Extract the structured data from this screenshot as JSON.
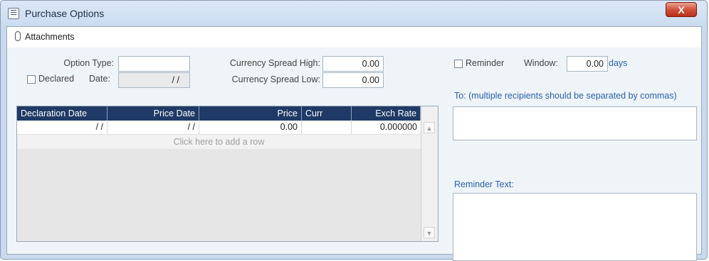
{
  "window": {
    "title": "Purchase Options",
    "close_label": "X"
  },
  "toolbar": {
    "attachments_label": "Attachments"
  },
  "form": {
    "option_type_label": "Option Type:",
    "option_type_value": "",
    "declared_label": "Declared",
    "declared_checked": false,
    "date_label": "Date:",
    "date_value": "/ /",
    "spread_high_label": "Currency Spread High:",
    "spread_high_value": "0.00",
    "spread_low_label": "Currency Spread Low:",
    "spread_low_value": "0.00"
  },
  "grid": {
    "columns": [
      "Declaration Date",
      "Price Date",
      "Price",
      "Curr",
      "Exch Rate"
    ],
    "rows": [
      {
        "declaration_date": "/ /",
        "price_date": "/ /",
        "price": "0.00",
        "curr": "",
        "exch_rate": "0.000000"
      }
    ],
    "add_row_label": "Click here to add a row"
  },
  "reminder": {
    "label": "Reminder",
    "checked": false,
    "window_label": "Window:",
    "window_value": "0.00",
    "days_label": "days",
    "to_label": "To: (multiple recipients should be separated by commas)",
    "to_value": "",
    "text_label": "Reminder Text:",
    "text_value": ""
  },
  "colors": {
    "grid_header": "#1f3a66",
    "link": "#2a62b0",
    "close_button": "#c8452f"
  }
}
